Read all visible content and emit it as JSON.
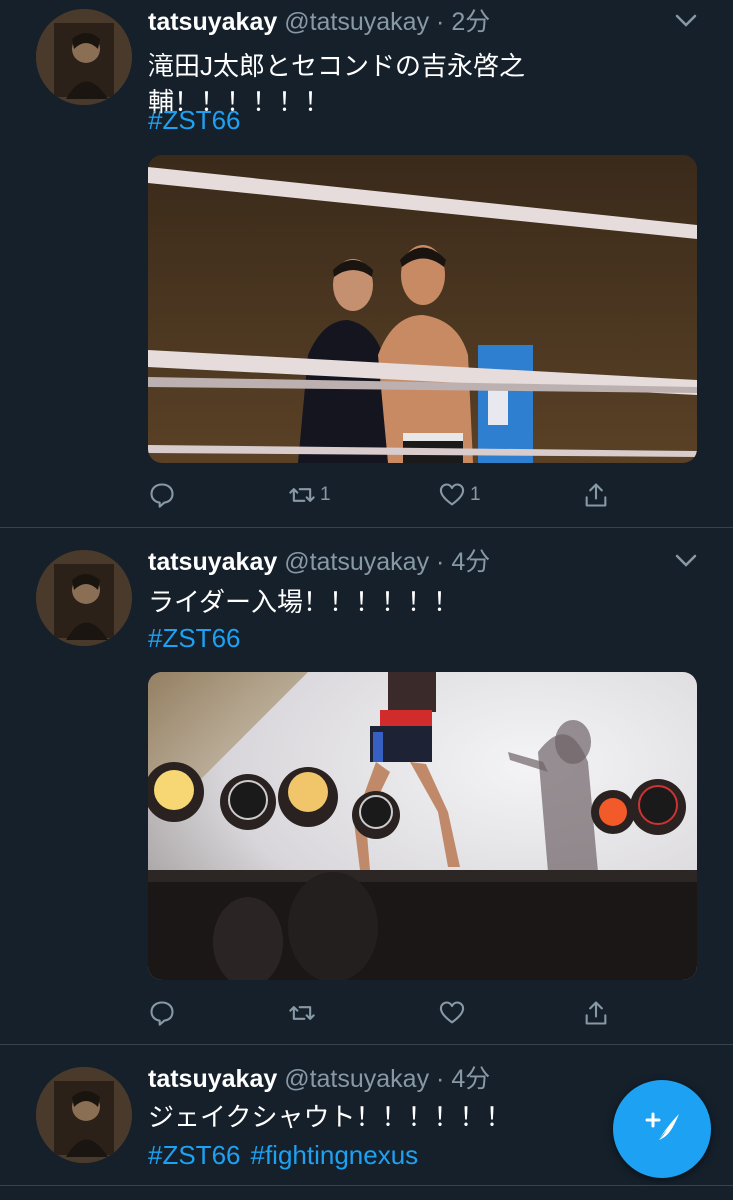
{
  "tweets": [
    {
      "name": "tatsuyakay",
      "handle": "@tatsuyakay",
      "time": "2分",
      "text_line1": "滝田J太郎とセコンドの吉永啓之",
      "text_line2": "輔！！！！！！",
      "hashtags": [
        "#ZST66"
      ],
      "media_icon": "ring-photo",
      "replies": "",
      "retweets": "1",
      "likes": "1"
    },
    {
      "name": "tatsuyakay",
      "handle": "@tatsuyakay",
      "time": "4分",
      "text_line1": "ライダー入場！！！！！！",
      "hashtags": [
        "#ZST66"
      ],
      "media_icon": "entrance-photo",
      "replies": "",
      "retweets": "",
      "likes": ""
    },
    {
      "name": "tatsuyakay",
      "handle": "@tatsuyakay",
      "time": "4分",
      "text_line1": "ジェイクシャウト！！！！！！",
      "hashtags": [
        "#ZST66",
        "#fightingnexus"
      ]
    }
  ],
  "compose_icon": "compose-tweet-icon",
  "colors": {
    "background": "#15202b",
    "accent": "#1da1f2",
    "muted": "#8899a6",
    "divider": "#38444d"
  }
}
